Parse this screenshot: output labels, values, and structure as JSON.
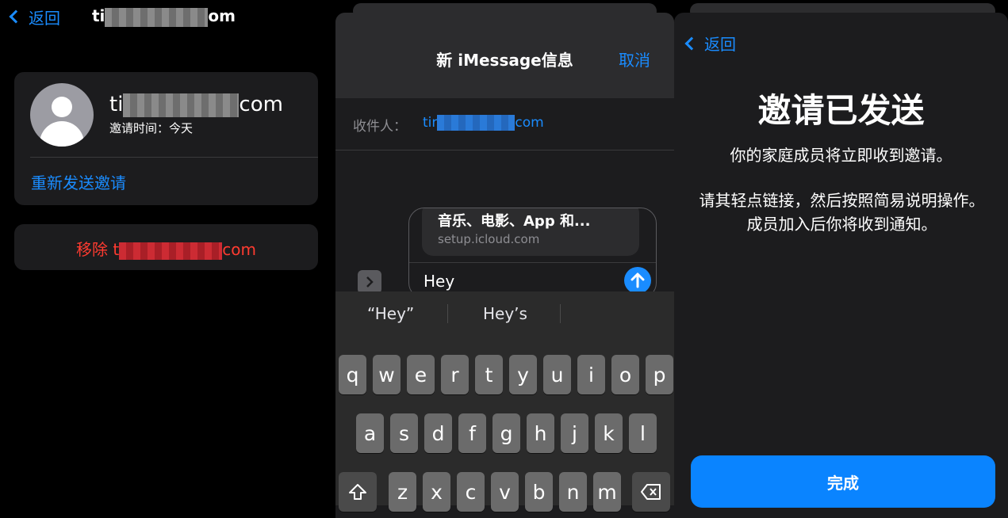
{
  "panel1": {
    "nav": {
      "back_label": "返回",
      "title_prefix": "ti",
      "title_suffix": "om"
    },
    "member": {
      "email_prefix": "ti",
      "email_suffix": "com",
      "invite_time": "邀请时间：今天"
    },
    "resend_label": "重新发送邀请",
    "remove_prefix": "移除 t",
    "remove_suffix": "com"
  },
  "panel2": {
    "title": "新 iMessage信息",
    "cancel_label": "取消",
    "to_label": "收件人：",
    "to_prefix": "tir",
    "to_suffix": "com",
    "link_title": "音乐、电影、App 和...",
    "link_url": "setup.icloud.com",
    "message_text": "Hey",
    "suggestions": [
      "“Hey”",
      "Hey’s"
    ],
    "keys_row1": [
      "q",
      "w",
      "e",
      "r",
      "t",
      "y",
      "u",
      "i",
      "o",
      "p"
    ],
    "keys_row2": [
      "a",
      "s",
      "d",
      "f",
      "g",
      "h",
      "j",
      "k",
      "l"
    ],
    "keys_row3": [
      "z",
      "x",
      "c",
      "v",
      "b",
      "n",
      "m"
    ]
  },
  "panel3": {
    "back_label": "返回",
    "headline": "邀请已发送",
    "subtitle": "你的家庭成员将立即收到邀请。",
    "instructions": "请其轻点链接，然后按照简易说明操作。成员加入后你将收到通知。",
    "done_label": "完成"
  },
  "colors": {
    "accent": "#1a8cff",
    "destructive": "#ff3b30",
    "primary_button": "#0a84ff"
  }
}
